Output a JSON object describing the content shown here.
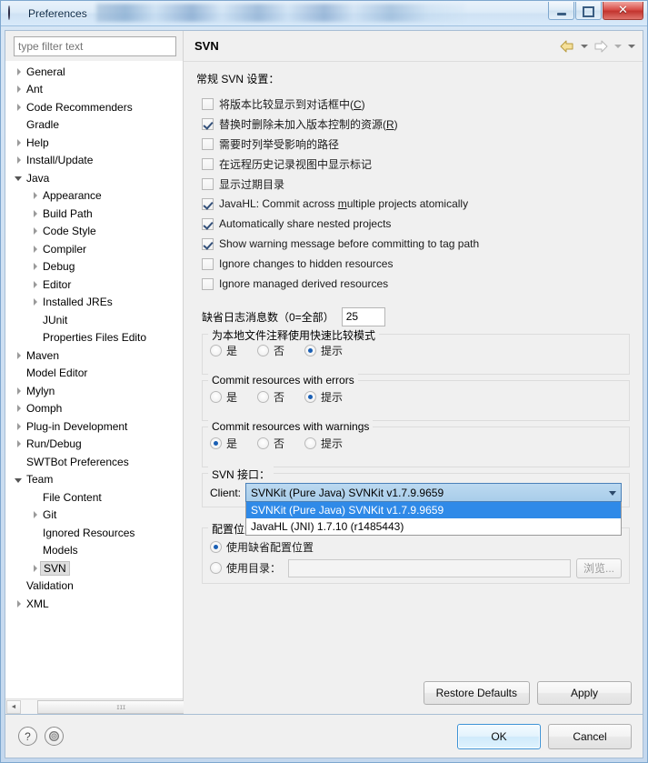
{
  "window": {
    "title": "Preferences",
    "buttons": {
      "minimize": "minimize-button",
      "maximize": "maximize-button",
      "close": "✕"
    }
  },
  "sidebar": {
    "filter_placeholder": "type filter text",
    "filter_value": "",
    "items": [
      {
        "label": "General",
        "depth": 0,
        "arrow": "closed",
        "selected": false
      },
      {
        "label": "Ant",
        "depth": 0,
        "arrow": "closed",
        "selected": false
      },
      {
        "label": "Code Recommenders",
        "depth": 0,
        "arrow": "closed",
        "selected": false
      },
      {
        "label": "Gradle",
        "depth": 0,
        "arrow": "none",
        "selected": false
      },
      {
        "label": "Help",
        "depth": 0,
        "arrow": "closed",
        "selected": false
      },
      {
        "label": "Install/Update",
        "depth": 0,
        "arrow": "closed",
        "selected": false
      },
      {
        "label": "Java",
        "depth": 0,
        "arrow": "open",
        "selected": false
      },
      {
        "label": "Appearance",
        "depth": 1,
        "arrow": "closed",
        "selected": false
      },
      {
        "label": "Build Path",
        "depth": 1,
        "arrow": "closed",
        "selected": false
      },
      {
        "label": "Code Style",
        "depth": 1,
        "arrow": "closed",
        "selected": false
      },
      {
        "label": "Compiler",
        "depth": 1,
        "arrow": "closed",
        "selected": false
      },
      {
        "label": "Debug",
        "depth": 1,
        "arrow": "closed",
        "selected": false
      },
      {
        "label": "Editor",
        "depth": 1,
        "arrow": "closed",
        "selected": false
      },
      {
        "label": "Installed JREs",
        "depth": 1,
        "arrow": "closed",
        "selected": false
      },
      {
        "label": "JUnit",
        "depth": 1,
        "arrow": "none",
        "selected": false
      },
      {
        "label": "Properties Files Edito",
        "depth": 1,
        "arrow": "none",
        "selected": false
      },
      {
        "label": "Maven",
        "depth": 0,
        "arrow": "closed",
        "selected": false
      },
      {
        "label": "Model Editor",
        "depth": 0,
        "arrow": "none",
        "selected": false
      },
      {
        "label": "Mylyn",
        "depth": 0,
        "arrow": "closed",
        "selected": false
      },
      {
        "label": "Oomph",
        "depth": 0,
        "arrow": "closed",
        "selected": false
      },
      {
        "label": "Plug-in Development",
        "depth": 0,
        "arrow": "closed",
        "selected": false
      },
      {
        "label": "Run/Debug",
        "depth": 0,
        "arrow": "closed",
        "selected": false
      },
      {
        "label": "SWTBot Preferences",
        "depth": 0,
        "arrow": "none",
        "selected": false
      },
      {
        "label": "Team",
        "depth": 0,
        "arrow": "open",
        "selected": false
      },
      {
        "label": "File Content",
        "depth": 1,
        "arrow": "none",
        "selected": false
      },
      {
        "label": "Git",
        "depth": 1,
        "arrow": "closed",
        "selected": false
      },
      {
        "label": "Ignored Resources",
        "depth": 1,
        "arrow": "none",
        "selected": false
      },
      {
        "label": "Models",
        "depth": 1,
        "arrow": "none",
        "selected": false
      },
      {
        "label": "SVN",
        "depth": 1,
        "arrow": "closed",
        "selected": true
      },
      {
        "label": "Validation",
        "depth": 0,
        "arrow": "none",
        "selected": false
      },
      {
        "label": "XML",
        "depth": 0,
        "arrow": "closed",
        "selected": false
      }
    ],
    "hscroll": {
      "left_arrow": "◄",
      "right_arrow": "►",
      "grip": "ɪɪɪ"
    }
  },
  "page": {
    "title": "SVN",
    "nav": {
      "back": "back-arrow",
      "back_menu": "▾",
      "forward": "forward-arrow",
      "forward_menu": "▾",
      "view_menu": "▾"
    },
    "section_label": "常规 SVN 设置：",
    "checkboxes": [
      {
        "label": "将版本比较显示到对话框中(C)",
        "checked": false,
        "mnemonic": "C"
      },
      {
        "label": "替换时删除未加入版本控制的资源(R)",
        "checked": true,
        "mnemonic": "R"
      },
      {
        "label": "需要时列举受影响的路径",
        "checked": false,
        "mnemonic": ""
      },
      {
        "label": "在远程历史记录视图中显示标记",
        "checked": false,
        "mnemonic": ""
      },
      {
        "label": "显示过期目录",
        "checked": false,
        "mnemonic": ""
      },
      {
        "label": "JavaHL: Commit across multiple projects atomically",
        "checked": true,
        "mnemonic": "m"
      },
      {
        "label": "Automatically share nested projects",
        "checked": true,
        "mnemonic": ""
      },
      {
        "label": "Show warning message before committing to tag path",
        "checked": true,
        "mnemonic": ""
      },
      {
        "label": "Ignore changes to hidden resources",
        "checked": false,
        "mnemonic": ""
      },
      {
        "label": "Ignore managed derived resources",
        "checked": false,
        "mnemonic": ""
      }
    ],
    "log_messages": {
      "label": "缺省日志消息数（0=全部）",
      "value": "25"
    },
    "radio_groups": [
      {
        "title": "为本地文件注释使用快速比较模式",
        "options": [
          {
            "label": "是",
            "selected": false
          },
          {
            "label": "否",
            "selected": false
          },
          {
            "label": "提示",
            "selected": true
          }
        ]
      },
      {
        "title": "Commit resources with errors",
        "options": [
          {
            "label": "是",
            "selected": false
          },
          {
            "label": "否",
            "selected": false
          },
          {
            "label": "提示",
            "selected": true
          }
        ]
      },
      {
        "title": "Commit resources with warnings",
        "options": [
          {
            "label": "是",
            "selected": true
          },
          {
            "label": "否",
            "selected": false
          },
          {
            "label": "提示",
            "selected": false
          }
        ]
      }
    ],
    "svn_interface": {
      "group_title": "SVN 接口：",
      "client_label": "Client:",
      "selected": "SVNKit (Pure Java) SVNKit v1.7.9.9659",
      "options": [
        "SVNKit (Pure Java) SVNKit v1.7.9.9659",
        "JavaHL (JNI) 1.7.10 (r1485443)"
      ],
      "highlighted_index": 0
    },
    "config_location": {
      "group_title": "配置位置：",
      "default_option": {
        "label": "使用缺省配置位置",
        "selected": true
      },
      "dir_option": {
        "label": "使用目录：",
        "selected": false
      },
      "dir_value": "",
      "browse_label": "浏览..."
    },
    "buttons": {
      "restore_defaults": "Restore Defaults",
      "restore_mnemonic": "D",
      "apply": "Apply",
      "apply_mnemonic": "A"
    }
  },
  "footer": {
    "help_icon": "?",
    "secure_icon": "fingerprint-icon",
    "ok": "OK",
    "cancel": "Cancel"
  },
  "colors": {
    "accent_blue": "#2f8ae8",
    "combo_fill": "#a9cdea",
    "selected_tree": "#dedede",
    "close_red": "#c2352f"
  }
}
